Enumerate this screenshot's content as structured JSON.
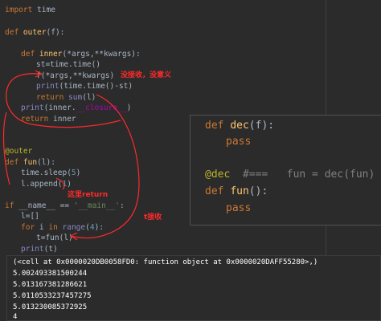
{
  "code_lines": [
    "import time",
    "def outer(f):",
    "def inner(*args,**kwargs):",
    "st=time.time()",
    "f(*args,**kwargs)",
    "print(time.time()-st)",
    "return sum(l)",
    "print(inner.__closure__)",
    "return inner",
    "@outer",
    "def fun(l):",
    "time.sleep(5)",
    "l.append(1)",
    "if __name__ == '__main__':",
    "l=[]",
    "for i in range(4):",
    "t=fun(l)",
    "print(t)"
  ],
  "annotations": {
    "no_receive": "没接收，没意义",
    "return_here": "这里return",
    "t_receive": "t接收"
  },
  "popup_lines": [
    "def dec(f):",
    "pass",
    "@dec  #===   fun = dec(fun)",
    "def fun():",
    "pass"
  ],
  "console_lines": [
    "(<cell at 0x0000020DB0058FD0: function object at 0x0000020DAFF55280>,)",
    "5.002493381500244",
    "5.013167381286621",
    "5.0110533237457275",
    "5.013230085372925",
    "4"
  ],
  "colors": {
    "keyword": "#cc7832",
    "function": "#ffc66d",
    "annotation": "#ff2a2a",
    "background": "#2b2b2b"
  }
}
